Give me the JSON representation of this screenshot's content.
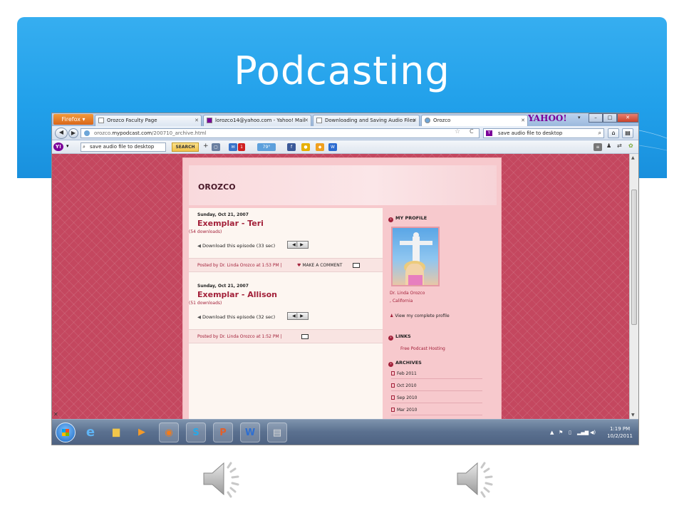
{
  "slide": {
    "title": "Podcasting",
    "colors": {
      "banner": "#21a0ea",
      "blog_accent": "#a3213a",
      "page_bg": "#c4475f"
    }
  },
  "browser": {
    "app_button": "Firefox",
    "tabs": [
      {
        "label": "Orozco Faculty Page",
        "icon": "page-icon"
      },
      {
        "label": "lorozco14@yahoo.com - Yahoo! Mail",
        "icon": "mail-icon"
      },
      {
        "label": "Downloading and Saving Audio Files",
        "icon": "page-icon"
      },
      {
        "label": "Orozco",
        "icon": "podcast-icon",
        "active": true
      }
    ],
    "new_tab": "+",
    "yahoo_logo": "YAHOO!",
    "url_prefix": "orozco.",
    "url_domain": "mypodcast.com",
    "url_path": "/200710_archive.html",
    "search_value": "save audio file to desktop",
    "window_buttons": [
      "–",
      "□",
      "✕"
    ]
  },
  "yahoo_toolbar": {
    "search_value": "save audio file to desktop",
    "search_button": "SEARCH",
    "mail_badge": "1",
    "weather": "79°"
  },
  "blog": {
    "name": "OROZCO",
    "posts": [
      {
        "date": "Sunday, Oct 21, 2007",
        "title": "Exemplar - Teri",
        "downloads": "(54 downloads)",
        "download_link": "Download this episode (33 sec)",
        "posted_by": "Posted by Dr. Linda Orozco at 1:53 PM |",
        "comment": "MAKE A COMMENT"
      },
      {
        "date": "Sunday, Oct 21, 2007",
        "title": "Exemplar - Allison",
        "downloads": "(51 downloads)",
        "download_link": "Download this episode (32 sec)",
        "posted_by": "Posted by Dr. Linda Orozco at 1:52 PM |"
      }
    ],
    "sidebar": {
      "profile_heading": "MY PROFILE",
      "profile_name": "Dr. Linda Orozco",
      "profile_location": ", California",
      "view_profile": "View my complete profile",
      "links_heading": "LINKS",
      "links": [
        "Free Podcast Hosting"
      ],
      "archives_heading": "ARCHIVES",
      "archives": [
        "Feb 2011",
        "Oct 2010",
        "Sep 2010",
        "Mar 2010"
      ]
    }
  },
  "taskbar": {
    "time": "1:19 PM",
    "date": "10/2/2011",
    "apps": [
      "internet-explorer-icon",
      "folder-icon",
      "media-player-icon",
      "firefox-icon",
      "skype-icon",
      "powerpoint-icon",
      "word-icon",
      "document-icon"
    ]
  }
}
